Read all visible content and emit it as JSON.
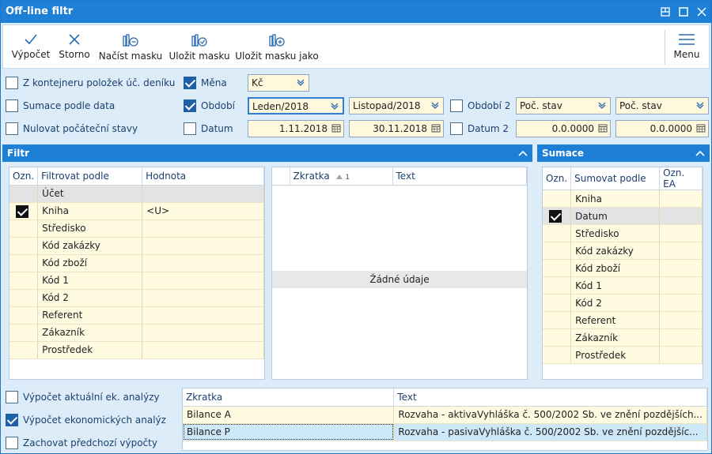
{
  "window": {
    "title": "Off-line filtr"
  },
  "toolbar": {
    "vypocet": "Výpočet",
    "storno": "Storno",
    "nacist_masku": "Načíst masku",
    "ulozit_masku": "Uložit masku",
    "ulozit_masku_jako": "Uložit masku jako",
    "menu": "Menu"
  },
  "options": {
    "z_kontejneru": "Z kontejneru položek úč. deníku",
    "sumace_podle_data": "Sumace podle data",
    "nulovat": "Nulovat počáteční stavy",
    "mena_label": "Měna",
    "mena_value": "Kč",
    "obdobi_label": "Období",
    "obdobi_from": "Leden/2018",
    "obdobi_to": "Listopad/2018",
    "datum_label": "Datum",
    "datum_from": "1.11.2018",
    "datum_to": "30.11.2018",
    "obdobi2_label": "Období 2",
    "obdobi2_from": "Poč. stav",
    "obdobi2_to": "Poč. stav",
    "datum2_label": "Datum 2",
    "datum2_from": "0.0.0000",
    "datum2_to": "0.0.0000"
  },
  "filtr": {
    "title": "Filtr",
    "columns": [
      "Ozn.",
      "Filtrovat podle",
      "Hodnota"
    ],
    "rows": [
      {
        "label": "Účet",
        "value": "",
        "checked": false
      },
      {
        "label": "Kniha",
        "value": "<U>",
        "checked": true
      },
      {
        "label": "Středisko",
        "value": "",
        "checked": false
      },
      {
        "label": "Kód zakázky",
        "value": "",
        "checked": false
      },
      {
        "label": "Kód zboží",
        "value": "",
        "checked": false
      },
      {
        "label": "Kód 1",
        "value": "",
        "checked": false
      },
      {
        "label": "Kód 2",
        "value": "",
        "checked": false
      },
      {
        "label": "Referent",
        "value": "",
        "checked": false
      },
      {
        "label": "Zákazník",
        "value": "",
        "checked": false
      },
      {
        "label": "Prostředek",
        "value": "",
        "checked": false
      }
    ],
    "detail_columns": [
      "Zkratka",
      "Text"
    ],
    "sort_index": "1",
    "empty": "Žádné údaje"
  },
  "sumace": {
    "title": "Sumace",
    "columns": [
      "Ozn.",
      "Sumovat podle",
      "Ozn. EA"
    ],
    "rows": [
      {
        "label": "Kniha",
        "checked": false
      },
      {
        "label": "Datum",
        "checked": true
      },
      {
        "label": "Středisko",
        "checked": false
      },
      {
        "label": "Kód zakázky",
        "checked": false
      },
      {
        "label": "Kód zboží",
        "checked": false
      },
      {
        "label": "Kód 1",
        "checked": false
      },
      {
        "label": "Kód 2",
        "checked": false
      },
      {
        "label": "Referent",
        "checked": false
      },
      {
        "label": "Zákazník",
        "checked": false
      },
      {
        "label": "Prostředek",
        "checked": false
      }
    ]
  },
  "bottom": {
    "vypocet_aktualni": "Výpočet aktuální ek. analýzy",
    "vypocet_ekonomickych": "Výpočet ekonomických analýz",
    "zachovat": "Zachovat předchozí výpočty",
    "columns": [
      "Zkratka",
      "Text"
    ],
    "rows": [
      {
        "zkratka": "Bilance A",
        "text": "Rozvaha - aktivaVyhláška č. 500/2002 Sb. ve znění pozdějších..."
      },
      {
        "zkratka": "Bilance P",
        "text": "Rozvaha - pasivaVyhláška č. 500/2002 Sb. ve znění pozdějšíc..."
      }
    ]
  },
  "colors": {
    "accent": "#1e7fd6",
    "field_bg": "#fff8dc",
    "window_bg": "#dcedf9"
  }
}
